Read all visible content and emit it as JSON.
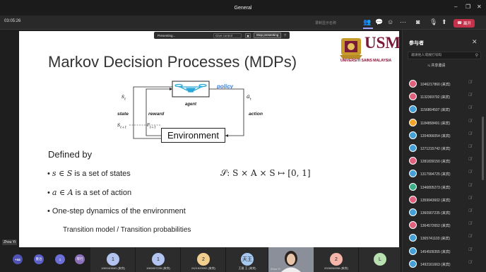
{
  "window": {
    "title": "General",
    "controls": [
      "–",
      "❐",
      "✕"
    ]
  },
  "meeting": {
    "timer": "03:05:26",
    "recording": "录制显示名称",
    "leave_label": "离开",
    "toolbar_icons": [
      "people-icon",
      "chat-icon",
      "react-icon",
      "more-icon",
      "camera-off-icon",
      "mic-off-icon",
      "share-icon"
    ]
  },
  "presenter_bar": {
    "label": "Presenting...",
    "view_control": "Give control",
    "stop_label": "Stop presenting"
  },
  "slide": {
    "title": "Markov Decision Processes (MDPs)",
    "logo_text": "UNIVERSITI SAINS MALAYSIA",
    "logo_mark": "USM",
    "diagram": {
      "agent": "agent",
      "policy": "policy",
      "environment": "Environment",
      "state": "state",
      "reward": "reward",
      "action": "action",
      "s_t": "s",
      "s_t_sub": "t",
      "a_t": "a",
      "a_t_sub": "t",
      "s_t1": "s",
      "s_t1_sub": "t+1",
      "r_t1": "r",
      "r_t1_sub": "t+1"
    },
    "defined_by": "Defined by",
    "bullets": [
      {
        "math": "s ∈ S",
        "text": " is a set of states"
      },
      {
        "math": "a ∈ A",
        "text": " is a set of action"
      },
      {
        "math": "",
        "text": "One-step dynamics of the environment"
      }
    ],
    "formula": "𝒮: S × A × S ↦ [0, 1]",
    "transition": "Transition model / Transition probabilities"
  },
  "speaker_label": "Zhou Yi",
  "gallery": [
    {
      "name": "+44",
      "color": "#4f52b2"
    },
    {
      "name": "重治",
      "color": "#5b5fc7"
    },
    {
      "name": "1",
      "color": "#6c6fd6"
    },
    {
      "name": "琴行",
      "color": "#8b6fb8"
    },
    {
      "tile_name": "1080163663 (来宾)",
      "avatar": "1",
      "color": "#b4c4f1"
    },
    {
      "tile_name": "1060907235 (来宾)",
      "avatar": "1",
      "color": "#b4c4f1"
    },
    {
      "tile_name": "2421529992 (来宾)",
      "avatar": "2",
      "color": "#f2cf8f"
    },
    {
      "tile_name": "王维 王 (来宾)",
      "avatar": "天王",
      "color": "#a7c8ef"
    },
    {
      "tile_name": "Zhou Yi",
      "avatar": "",
      "color": "#000"
    },
    {
      "tile_name": "2028056398 (来宾)",
      "avatar": "2",
      "color": "#f5b5a8"
    },
    {
      "tile_name": "",
      "avatar": "L",
      "color": "#b8e0b0"
    }
  ],
  "panel": {
    "title": "参与者",
    "search_placeholder": "邀请他人或拨打号码",
    "share_invite": "共享邀请",
    "participants": [
      {
        "name": "1046217860 (来宾)",
        "color": "#e0607e"
      },
      {
        "name": "1132369792 (来宾)",
        "color": "#e0607e"
      },
      {
        "name": "1156804507 (来宾)",
        "color": "#44a1d8"
      },
      {
        "name": "1184858491 (来宾)",
        "color": "#f0a22a"
      },
      {
        "name": "1204066054 (来宾)",
        "color": "#44a1d8"
      },
      {
        "name": "1271215742 (来宾)",
        "color": "#44a1d8"
      },
      {
        "name": "1281839150 (来宾)",
        "color": "#e0607e"
      },
      {
        "name": "1317994725 (来宾)",
        "color": "#44a1d8"
      },
      {
        "name": "1346805273 (来宾)",
        "color": "#3cb08a"
      },
      {
        "name": "1359943602 (来宾)",
        "color": "#e0607e"
      },
      {
        "name": "1360907235 (来宾)",
        "color": "#44a1d8"
      },
      {
        "name": "1364572652 (来宾)",
        "color": "#e0607e"
      },
      {
        "name": "1365741103 (来宾)",
        "color": "#44a1d8"
      },
      {
        "name": "1454509355 (来宾)",
        "color": "#44a1d8"
      },
      {
        "name": "1492161663 (来宾)",
        "color": "#44a1d8"
      }
    ]
  }
}
